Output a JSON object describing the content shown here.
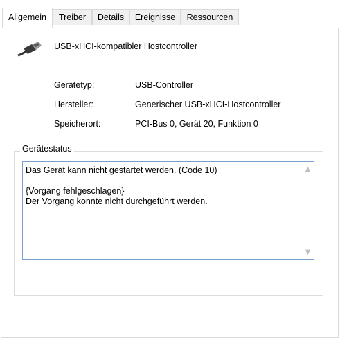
{
  "tabs": [
    "Allgemein",
    "Treiber",
    "Details",
    "Ereignisse",
    "Ressourcen"
  ],
  "device": {
    "name": "USB-xHCI-kompatibler Hostcontroller",
    "icon": "usb-cable-icon"
  },
  "properties": [
    {
      "label": "Gerätetyp:",
      "value": "USB-Controller"
    },
    {
      "label": "Hersteller:",
      "value": "Generischer USB-xHCI-Hostcontroller"
    },
    {
      "label": "Speicherort:",
      "value": "PCI-Bus 0, Gerät 20, Funktion 0"
    }
  ],
  "status": {
    "group_title": "Gerätestatus",
    "text": "Das Gerät kann nicht gestartet werden. (Code 10)\n\n{Vorgang fehlgeschlagen}\nDer Vorgang konnte nicht durchgeführt werden.",
    "scroll_up_icon": "chevron-up-icon",
    "scroll_down_icon": "chevron-down-icon"
  }
}
